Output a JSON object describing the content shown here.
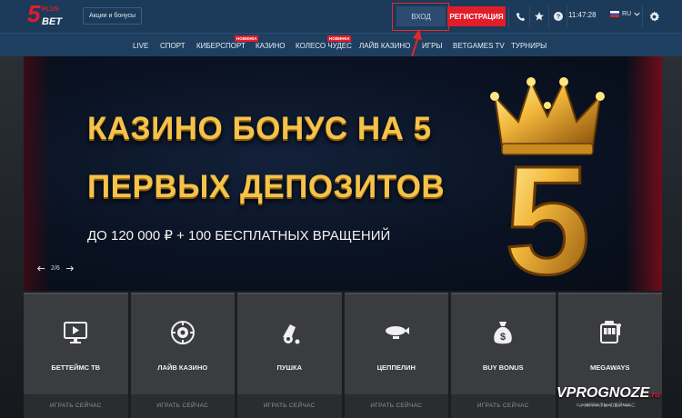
{
  "header": {
    "logo_number": "5",
    "logo_small": "PLUS",
    "logo_text": "BET",
    "promo": "Акции и бонусы",
    "login": "ВХОД",
    "register": "РЕГИСТРАЦИЯ",
    "time": "11:47:28",
    "lang": "RU",
    "icons": [
      "phone-icon",
      "star-icon",
      "help-icon",
      "flag-icon",
      "chevron-down-icon",
      "gear-icon"
    ]
  },
  "nav": {
    "items": [
      "LIVE",
      "СПОРТ",
      "КИБЕРСПОРТ",
      "КАЗИНО",
      "КОЛЕСО ЧУДЕС",
      "ЛАЙВ КАЗИНО",
      "ИГРЫ",
      "BETGAMES TV",
      "ТУРНИРЫ"
    ],
    "badge_new": "НОВИНКА"
  },
  "banner": {
    "title_line1": "КАЗИНО БОНУС НА 5",
    "title_line2": "ПЕРВЫХ ДЕПОЗИТОВ",
    "subtitle": "ДО 120 000 ₽ + 100 БЕСПЛАТНЫХ ВРАЩЕНИЙ",
    "pager": "2/6",
    "art_number": "5"
  },
  "tiles": [
    {
      "label": "БЕТТЕЙМС ТВ",
      "cta": "ИГРАТЬ СЕЙЧАС",
      "icon": "tv-play-icon"
    },
    {
      "label": "ЛАЙВ КАЗИНО",
      "cta": "ИГРАТЬ СЕЙЧАС",
      "icon": "roulette-icon"
    },
    {
      "label": "ПУШКА",
      "cta": "ИГРАТЬ СЕЙЧАС",
      "icon": "cannon-icon"
    },
    {
      "label": "ЦЕППЕЛИН",
      "cta": "ИГРАТЬ СЕЙЧАС",
      "icon": "zeppelin-icon"
    },
    {
      "label": "BUY BONUS",
      "cta": "ИГРАТЬ СЕЙЧАС",
      "icon": "money-bag-icon"
    },
    {
      "label": "MEGAWAYS",
      "cta": "ИГРАТЬ СЕЙЧАС",
      "icon": "slot-machine-icon"
    }
  ],
  "watermark": {
    "text": "VPROGNOZE",
    "suffix": ".ru",
    "tagline": "Сделанные ставки прогнозы"
  },
  "colors": {
    "accent": "#e11d2a",
    "header": "#1c3a5a",
    "nav": "#1f3f60",
    "gold": "#f5c24a",
    "tile": "#3a3c40"
  }
}
